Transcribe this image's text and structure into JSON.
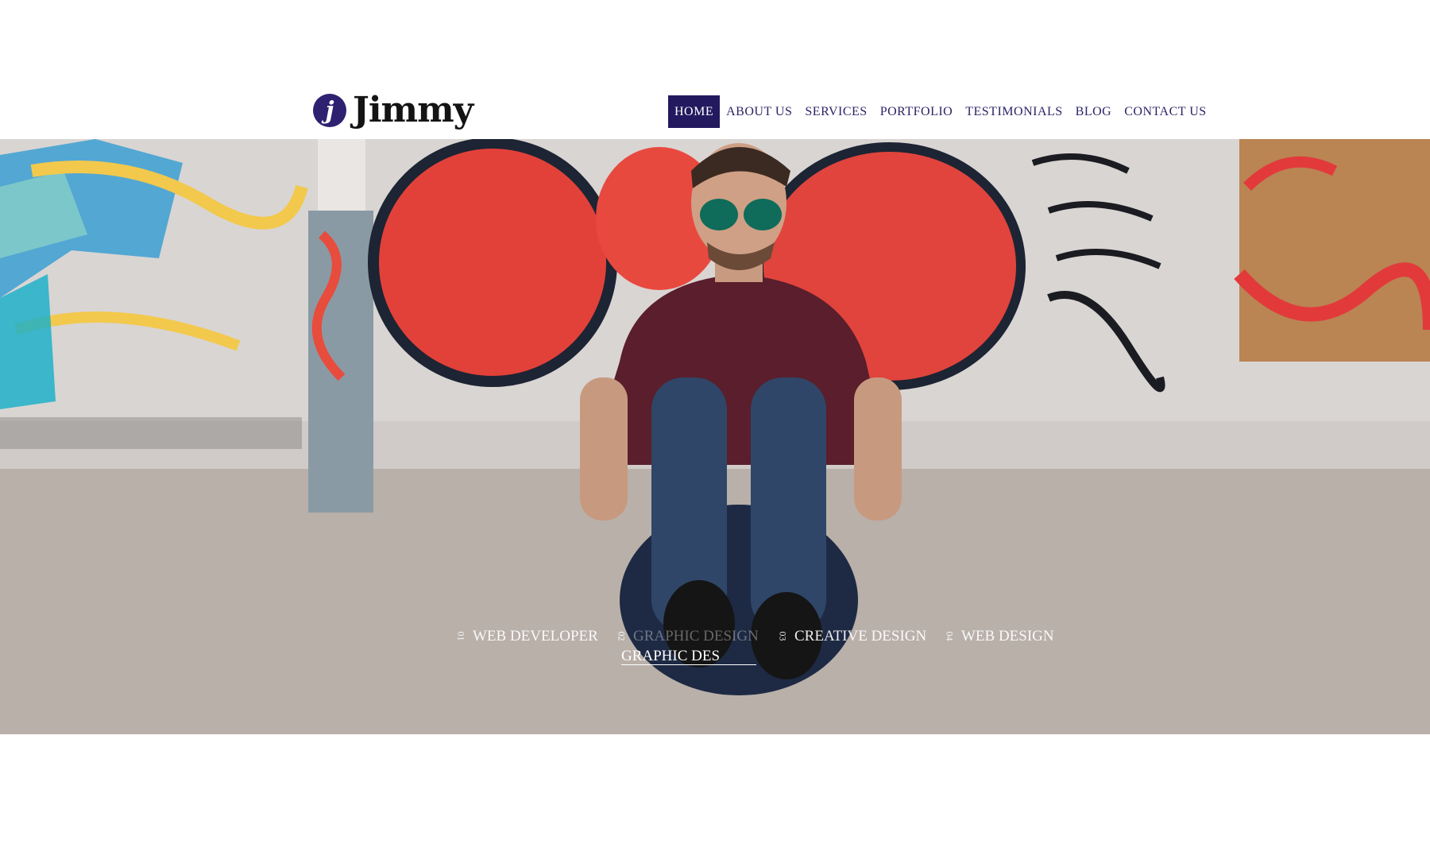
{
  "brand": {
    "logo_letter": "j",
    "name": "Jimmy",
    "badge_color": "#2e2170"
  },
  "nav": {
    "items": [
      {
        "label": "HOME",
        "active": true
      },
      {
        "label": "ABOUT US",
        "active": false
      },
      {
        "label": "SERVICES",
        "active": false
      },
      {
        "label": "PORTFOLIO",
        "active": false
      },
      {
        "label": "TESTIMONIALS",
        "active": false
      },
      {
        "label": "BLOG",
        "active": false
      },
      {
        "label": "CONTACT US",
        "active": false
      }
    ],
    "active_color": "#22195f"
  },
  "slider": {
    "tabs": [
      {
        "num": "01",
        "label": "WEB DEVELOPER"
      },
      {
        "num": "02",
        "label": "GRAPHIC DESIGN"
      },
      {
        "num": "03",
        "label": "CREATIVE DESIGN"
      },
      {
        "num": "04",
        "label": "WEB DESIGN"
      }
    ],
    "active_caption": "GRAPHIC DES"
  }
}
